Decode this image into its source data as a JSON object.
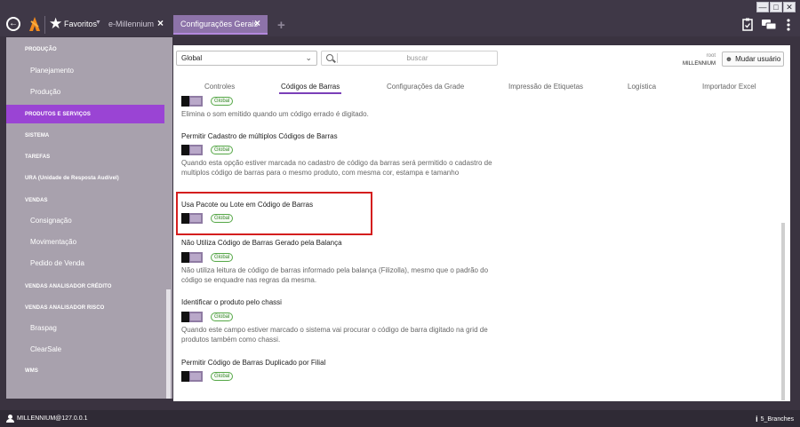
{
  "window": {
    "controls": [
      "minimize",
      "maximize",
      "close"
    ]
  },
  "topbar": {
    "favorites_label": "Favoritos",
    "tabs": [
      {
        "label": "e-Millennium",
        "active": false
      },
      {
        "label": "Configurações Gerais",
        "active": true
      }
    ],
    "icons": [
      "back-icon",
      "millennium-logo",
      "star-icon",
      "close-icon",
      "plus-icon",
      "clipboard-icon",
      "chat-icon",
      "more-vertical-icon"
    ]
  },
  "sidebar": {
    "items": [
      {
        "label": "PRODUÇÃO",
        "type": "category"
      },
      {
        "label": "Planejamento",
        "type": "sub"
      },
      {
        "label": "Produção",
        "type": "sub"
      },
      {
        "label": "PRODUTOS E SERVIÇOS",
        "type": "category",
        "active": true
      },
      {
        "label": "SISTEMA",
        "type": "category"
      },
      {
        "label": "TAREFAS",
        "type": "category"
      },
      {
        "label": "URA (Unidade de Resposta Audível)",
        "type": "category"
      },
      {
        "label": "VENDAS",
        "type": "category"
      },
      {
        "label": "Consignação",
        "type": "sub"
      },
      {
        "label": "Movimentação",
        "type": "sub"
      },
      {
        "label": "Pedido de Venda",
        "type": "sub"
      },
      {
        "label": "VENDAS ANALISADOR CRÉDITO",
        "type": "category"
      },
      {
        "label": "VENDAS ANALISADOR RISCO",
        "type": "category"
      },
      {
        "label": "Braspag",
        "type": "sub"
      },
      {
        "label": "ClearSale",
        "type": "sub"
      },
      {
        "label": "WMS",
        "type": "category"
      }
    ]
  },
  "toolbar": {
    "scope_select": "Global",
    "search_placeholder": "buscar",
    "user_small": "root",
    "user_name": "MILLENNIUM",
    "change_user_label": "Mudar usuário"
  },
  "tabs": [
    {
      "label": "Controles",
      "active": false
    },
    {
      "label": "Códigos de Barras",
      "active": true
    },
    {
      "label": "Configurações da Grade",
      "active": false
    },
    {
      "label": "Impressão de Etiquetas",
      "active": false
    },
    {
      "label": "Logística",
      "active": false
    },
    {
      "label": "Importador Excel",
      "active": false
    }
  ],
  "options": [
    {
      "title": "",
      "badge": "Global",
      "description": "Elimina o som emitido quando um código errado é digitado."
    },
    {
      "title": "Permitir Cadastro de múltiplos Códigos de Barras",
      "badge": "Global",
      "description": "Quando esta opção estiver marcada no cadastro de código da barras será permitido o cadastro de multiplos código de barras para o mesmo produto, com mesma cor, estampa e tamanho"
    },
    {
      "title": "Usa Pacote ou Lote em Código de Barras",
      "badge": "Global",
      "description": "",
      "highlighted": true
    },
    {
      "title": "Não Utiliza Código de Barras Gerado pela Balança",
      "badge": "Global",
      "description": "Não utiliza leitura de código de barras informado pela balança (Filizolla), mesmo que o padrão do código se enquadre nas regras da mesma."
    },
    {
      "title": "Identificar o produto pelo chassi",
      "badge": "Global",
      "description": "Quando este campo estiver marcado o sistema vai procurar o código de barra digitado na grid de produtos também como chassi."
    },
    {
      "title": "Permitir Código de Barras Duplicado por Filial",
      "badge": "Global",
      "description": ""
    }
  ],
  "statusbar": {
    "user": "MILLENNIUM@127.0.0.1",
    "branch": "5_Branches"
  },
  "colors": {
    "accent": "#9a44d4",
    "active_tab": "#8d73a9",
    "highlight_border": "#d41e1e",
    "badge_green": "#58a94a"
  }
}
